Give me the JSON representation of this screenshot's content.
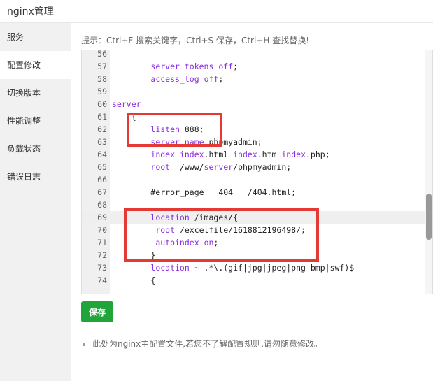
{
  "window": {
    "title": "nginx管理"
  },
  "sidebar": {
    "items": [
      {
        "label": "服务"
      },
      {
        "label": "配置修改",
        "active": true
      },
      {
        "label": "切换版本"
      },
      {
        "label": "性能调整"
      },
      {
        "label": "负载状态"
      },
      {
        "label": "错误日志"
      }
    ]
  },
  "main": {
    "tip": "提示：Ctrl+F 搜索关键字，Ctrl+S 保存，Ctrl+H 查找替换!",
    "editor": {
      "lines": [
        {
          "no": "56",
          "code": ""
        },
        {
          "no": "57",
          "code": "        server_tokens off;"
        },
        {
          "no": "58",
          "code": "        access_log off;"
        },
        {
          "no": "59",
          "code": ""
        },
        {
          "no": "60",
          "code": "server"
        },
        {
          "no": "61",
          "code": "    {"
        },
        {
          "no": "62",
          "code": "        listen 888;"
        },
        {
          "no": "63",
          "code": "        server_name phpmyadmin;"
        },
        {
          "no": "64",
          "code": "        index index.html index.htm index.php;"
        },
        {
          "no": "65",
          "code": "        root  /www/server/phpmyadmin;"
        },
        {
          "no": "66",
          "code": ""
        },
        {
          "no": "67",
          "code": "        #error_page   404   /404.html;"
        },
        {
          "no": "68",
          "code": ""
        },
        {
          "no": "69",
          "code": "        location /images/{"
        },
        {
          "no": "70",
          "code": "         root /excelfile/1618812196498/;"
        },
        {
          "no": "71",
          "code": "         autoindex on;"
        },
        {
          "no": "72",
          "code": "        }"
        },
        {
          "no": "73",
          "code": "        location ~ .*\\.(gif|jpg|jpeg|png|bmp|swf)$"
        },
        {
          "no": "74",
          "code": "        {"
        }
      ]
    },
    "save_label": "保存",
    "note": "此处为nginx主配置文件,若您不了解配置规则,请勿随意修改。"
  },
  "colors": {
    "accent": "#20a53a",
    "highlight_box": "#e53935"
  }
}
